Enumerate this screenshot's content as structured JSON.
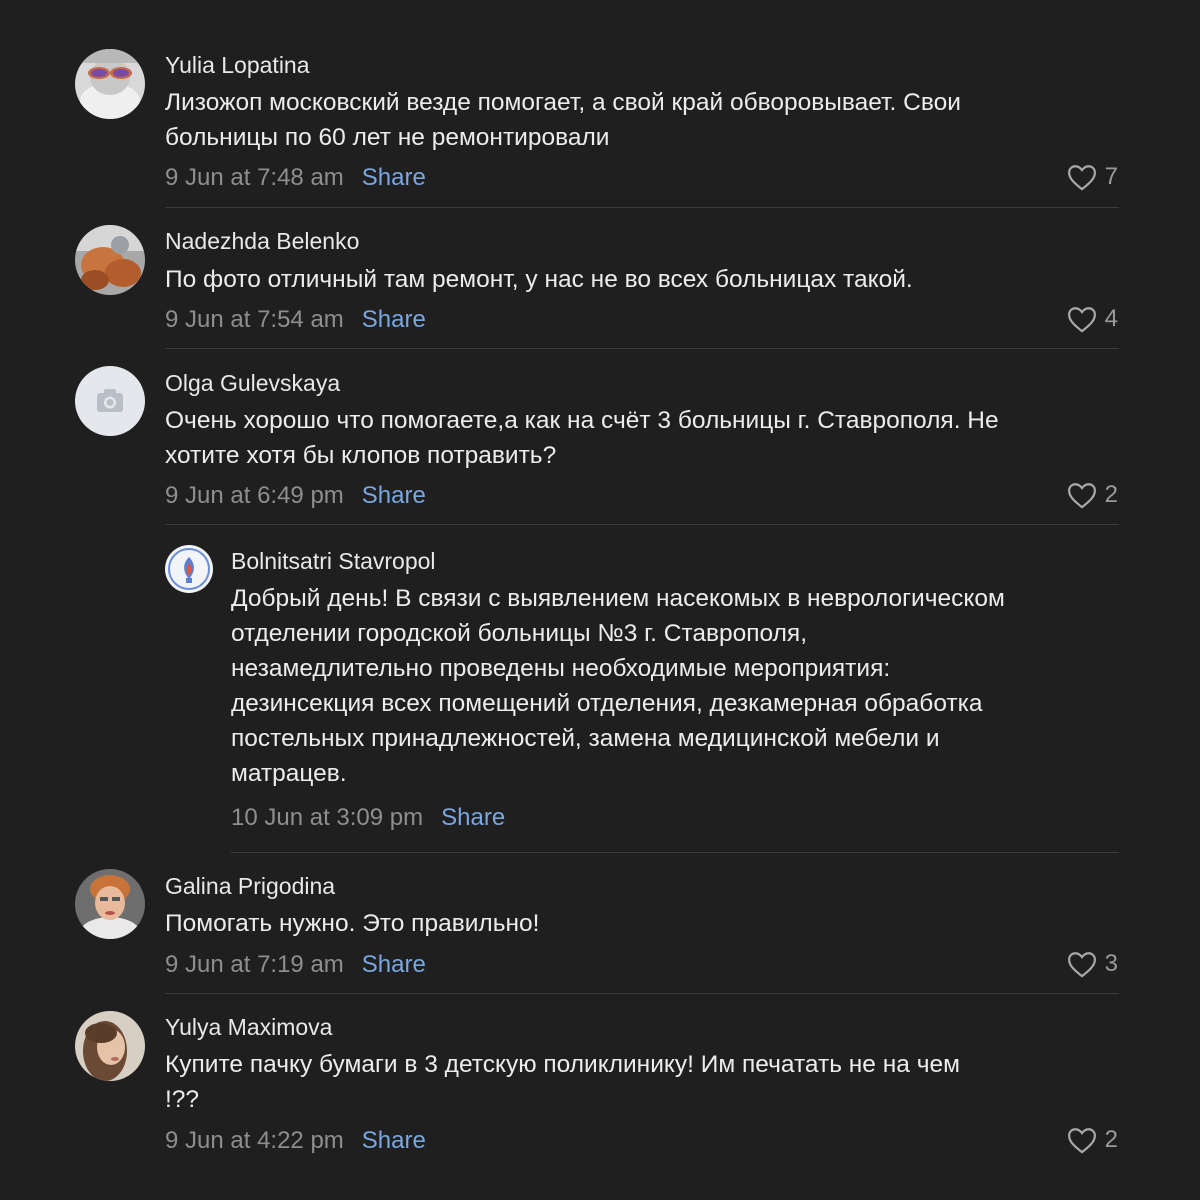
{
  "comments": [
    {
      "author": "Yulia Lopatina",
      "lines": [
        "Лизожоп московский везде помогает, а свой край обворовывает. Свои",
        "больницы по 60 лет не ремонтировали"
      ],
      "time": "9 Jun at 7:48 am",
      "share": "Share",
      "likes": "7"
    },
    {
      "author": "Nadezhda Belenko",
      "lines": [
        "По фото отличный там ремонт, у нас не во всех больницах такой."
      ],
      "time": "9 Jun at 7:54 am",
      "share": "Share",
      "likes": "4"
    },
    {
      "author": "Olga Gulevskaya",
      "lines": [
        "Очень хорошо что помогаете,а как на счёт 3 больницы г. Ставрополя. Не",
        "хотите хотя бы клопов потравить?"
      ],
      "time": "9 Jun at 6:49 pm",
      "share": "Share",
      "likes": "2"
    },
    {
      "author": "Bolnitsatri Stavropol",
      "lines": [
        "Добрый день! В связи с выявлением насекомых в неврологическом",
        "отделении городской больницы №3 г. Ставрополя,",
        "незамедлительно проведены необходимые мероприятия:",
        "дезинсекция всех помещений отделения, дезкамерная обработка",
        "постельных принадлежностей, замена медицинской мебели и",
        "матрацев."
      ],
      "time": "10 Jun at 3:09 pm",
      "share": "Share"
    },
    {
      "author": "Galina Prigodina",
      "lines": [
        "Помогать нужно. Это правильно!"
      ],
      "time": "9 Jun at 7:19 am",
      "share": "Share",
      "likes": "3"
    },
    {
      "author": "Yulya Maximova",
      "lines": [
        "Купите пачку бумаги в 3 детскую поликлинику! Им печатать не на чем",
        "!??"
      ],
      "time": "9 Jun at 4:22 pm",
      "share": "Share",
      "likes": "2"
    }
  ],
  "icons": {
    "like": "heart-icon",
    "placeholder_avatar": "camera-icon"
  },
  "colors": {
    "background": "#1f1f1f",
    "link": "#7aa7e0",
    "muted": "#8e8e8e"
  }
}
